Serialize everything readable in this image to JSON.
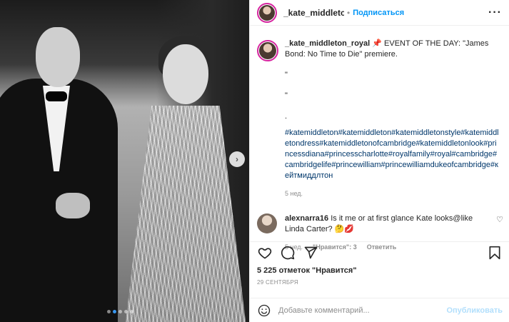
{
  "header": {
    "username": "_kate_middleton_ro",
    "separator": "•",
    "follow_label": "Подписаться",
    "more_label": "···"
  },
  "caption": {
    "username": "_kate_middleton_royal",
    "pin_emoji": "📌",
    "text": "EVENT OF THE DAY: \"James Bond: No Time to Die\" premiere.",
    "line1": "\"",
    "line2": "\"",
    "line3": ".",
    "hashtags": "#katemiddleton#katemiddleton#katemiddletonstyle#katemiddletondress#katemiddletonofcambridge#katemiddletonlook#princessdiana#princesscharlotte#royalfamily#royal#cambridge#cambridgelife#princewilliam#princewilliamdukeofcambridge#кейтмиддлтон",
    "time": "5 нед."
  },
  "comment": {
    "username": "alexnarra16",
    "text": "Is it me or at first glance Kate looks@like Linda Carter?",
    "emojis": "🤔💋",
    "time": "5 нед.",
    "likes": "\"Нравится\": 3",
    "reply_label": "Ответить",
    "heart": "♡"
  },
  "actions": {
    "like_icon": "heart-icon",
    "comment_icon": "comment-icon",
    "share_icon": "share-icon",
    "save_icon": "bookmark-icon"
  },
  "likes_text": "5 225 отметок \"Нравится\"",
  "date_text": "29 СЕНТЯБРЯ",
  "add_comment": {
    "placeholder": "Добавьте комментарий...",
    "publish_label": "Опубликовать"
  },
  "photo": {
    "next_arrow": "›",
    "accent": "#3897f0"
  }
}
